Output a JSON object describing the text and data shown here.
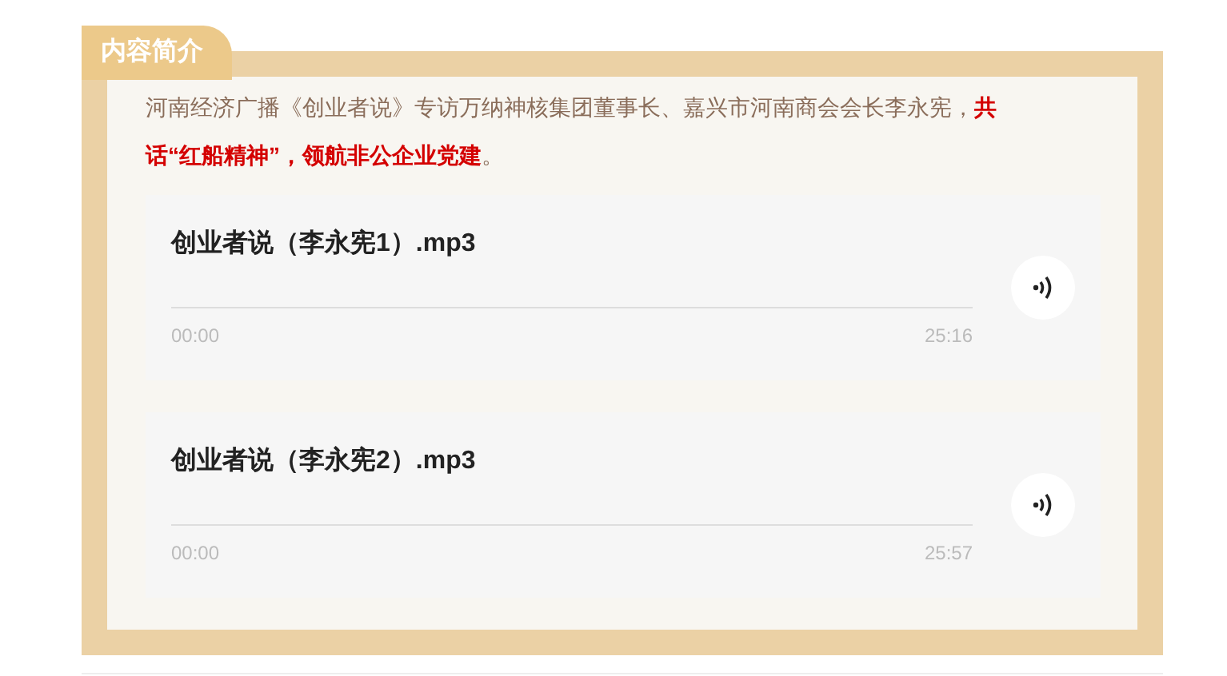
{
  "section": {
    "tab_label": "内容简介",
    "intro": [
      {
        "kind": "plain",
        "text": "河南经济广播《创业者说》专访万纳神核集团董事长、嘉兴市河南商会会长李永宪，"
      },
      {
        "kind": "emphasis",
        "text": "共话“红船精神”，领航非公企业党建"
      },
      {
        "kind": "plain",
        "text": "。"
      }
    ],
    "audio_tracks": [
      {
        "title": "创业者说（李永宪1）.mp3",
        "elapsed": "00:00",
        "duration": "25:16",
        "level": 0
      },
      {
        "title": "创业者说（李永宪2）.mp3",
        "elapsed": "00:00",
        "duration": "25:57",
        "level": 0
      }
    ]
  }
}
